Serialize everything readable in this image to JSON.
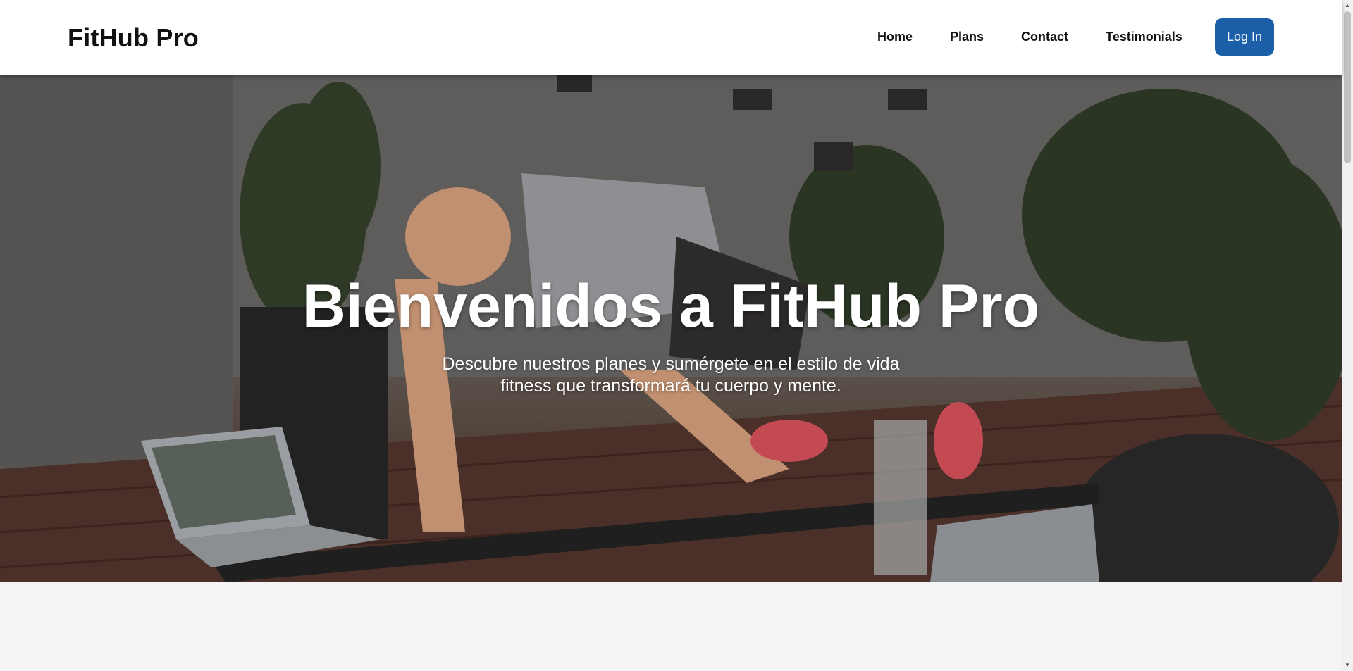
{
  "nav": {
    "brand": "FitHub Pro",
    "links": [
      "Home",
      "Plans",
      "Contact",
      "Testimonials"
    ],
    "login_label": "Log In"
  },
  "hero": {
    "title": "Bienvenidos a FitHub Pro",
    "subtitle": "Descubre nuestros planes y sumérgete en el estilo de vida fitness que transformará tu cuerpo y mente."
  },
  "colors": {
    "accent": "#1a5fa8",
    "nav_bg": "#ffffff",
    "page_bg": "#f4f4f4"
  },
  "icons": {
    "scroll_up": "triangle-up-icon",
    "scroll_down": "triangle-down-icon"
  }
}
